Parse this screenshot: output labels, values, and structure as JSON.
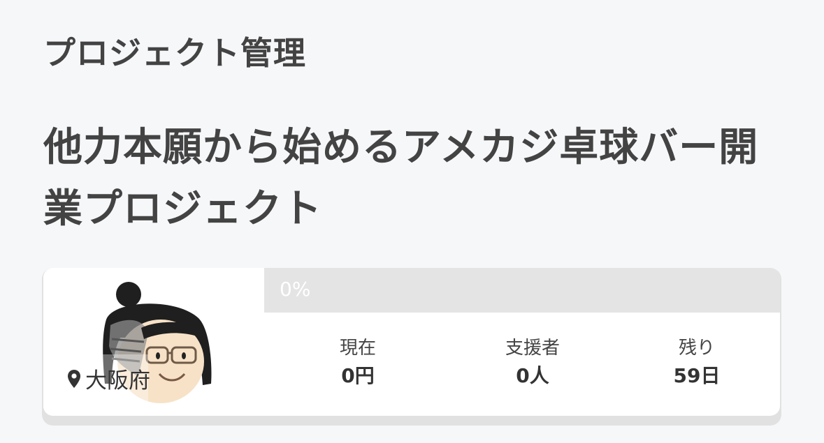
{
  "header": {
    "section_title": "プロジェクト管理"
  },
  "project": {
    "title": "他力本願から始めるアメカジ卓球バー開業プロジェクト",
    "location": "大阪府",
    "progress": {
      "percent": 0,
      "label": "0%"
    },
    "stats": {
      "current_label": "現在",
      "current_value": "0円",
      "supporters_label": "支援者",
      "supporters_value": "0人",
      "remaining_label": "残り",
      "remaining_value": "59日"
    }
  },
  "icons": {
    "location": "map-pin-icon"
  },
  "colors": {
    "progress_track": "#e4e4e4",
    "progress_fill": "#f39800",
    "page_background": "#f6f7f9"
  }
}
